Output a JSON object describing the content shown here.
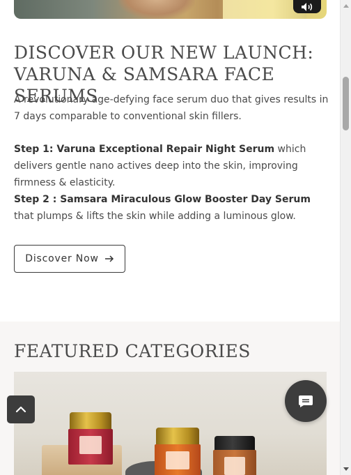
{
  "hero": {
    "mute_icon": "speaker-icon"
  },
  "launch": {
    "title_line1": "DISCOVER OUR NEW LAUNCH:",
    "title_line2": "VARUNA & SAMSARA FACE SERUMS",
    "intro": "A revolutionary age-defying face serum duo that gives results in 7 days comparable to conventional skin fillers.",
    "step1_bold": "Step 1: Varuna Exceptional Repair Night Serum",
    "step1_rest": " which delivers gentle nano actives deep into the skin, improving firmness & elasticity.",
    "step2_bold": "Step 2 : Samsara Miraculous Glow Booster Day Serum",
    "step2_rest": " that plumps & lifts the skin while adding a luminous glow.",
    "cta_label": "Discover Now",
    "cta_icon": "arrow-right-icon"
  },
  "featured": {
    "title": "FEATURED CATEGORIES"
  },
  "floating": {
    "scroll_top_icon": "chevron-up-icon",
    "chat_icon": "chat-icon"
  },
  "colors": {
    "text": "#4a4a4a",
    "section_bg": "#f8f6f5",
    "button_dark": "#3c3c3c"
  }
}
